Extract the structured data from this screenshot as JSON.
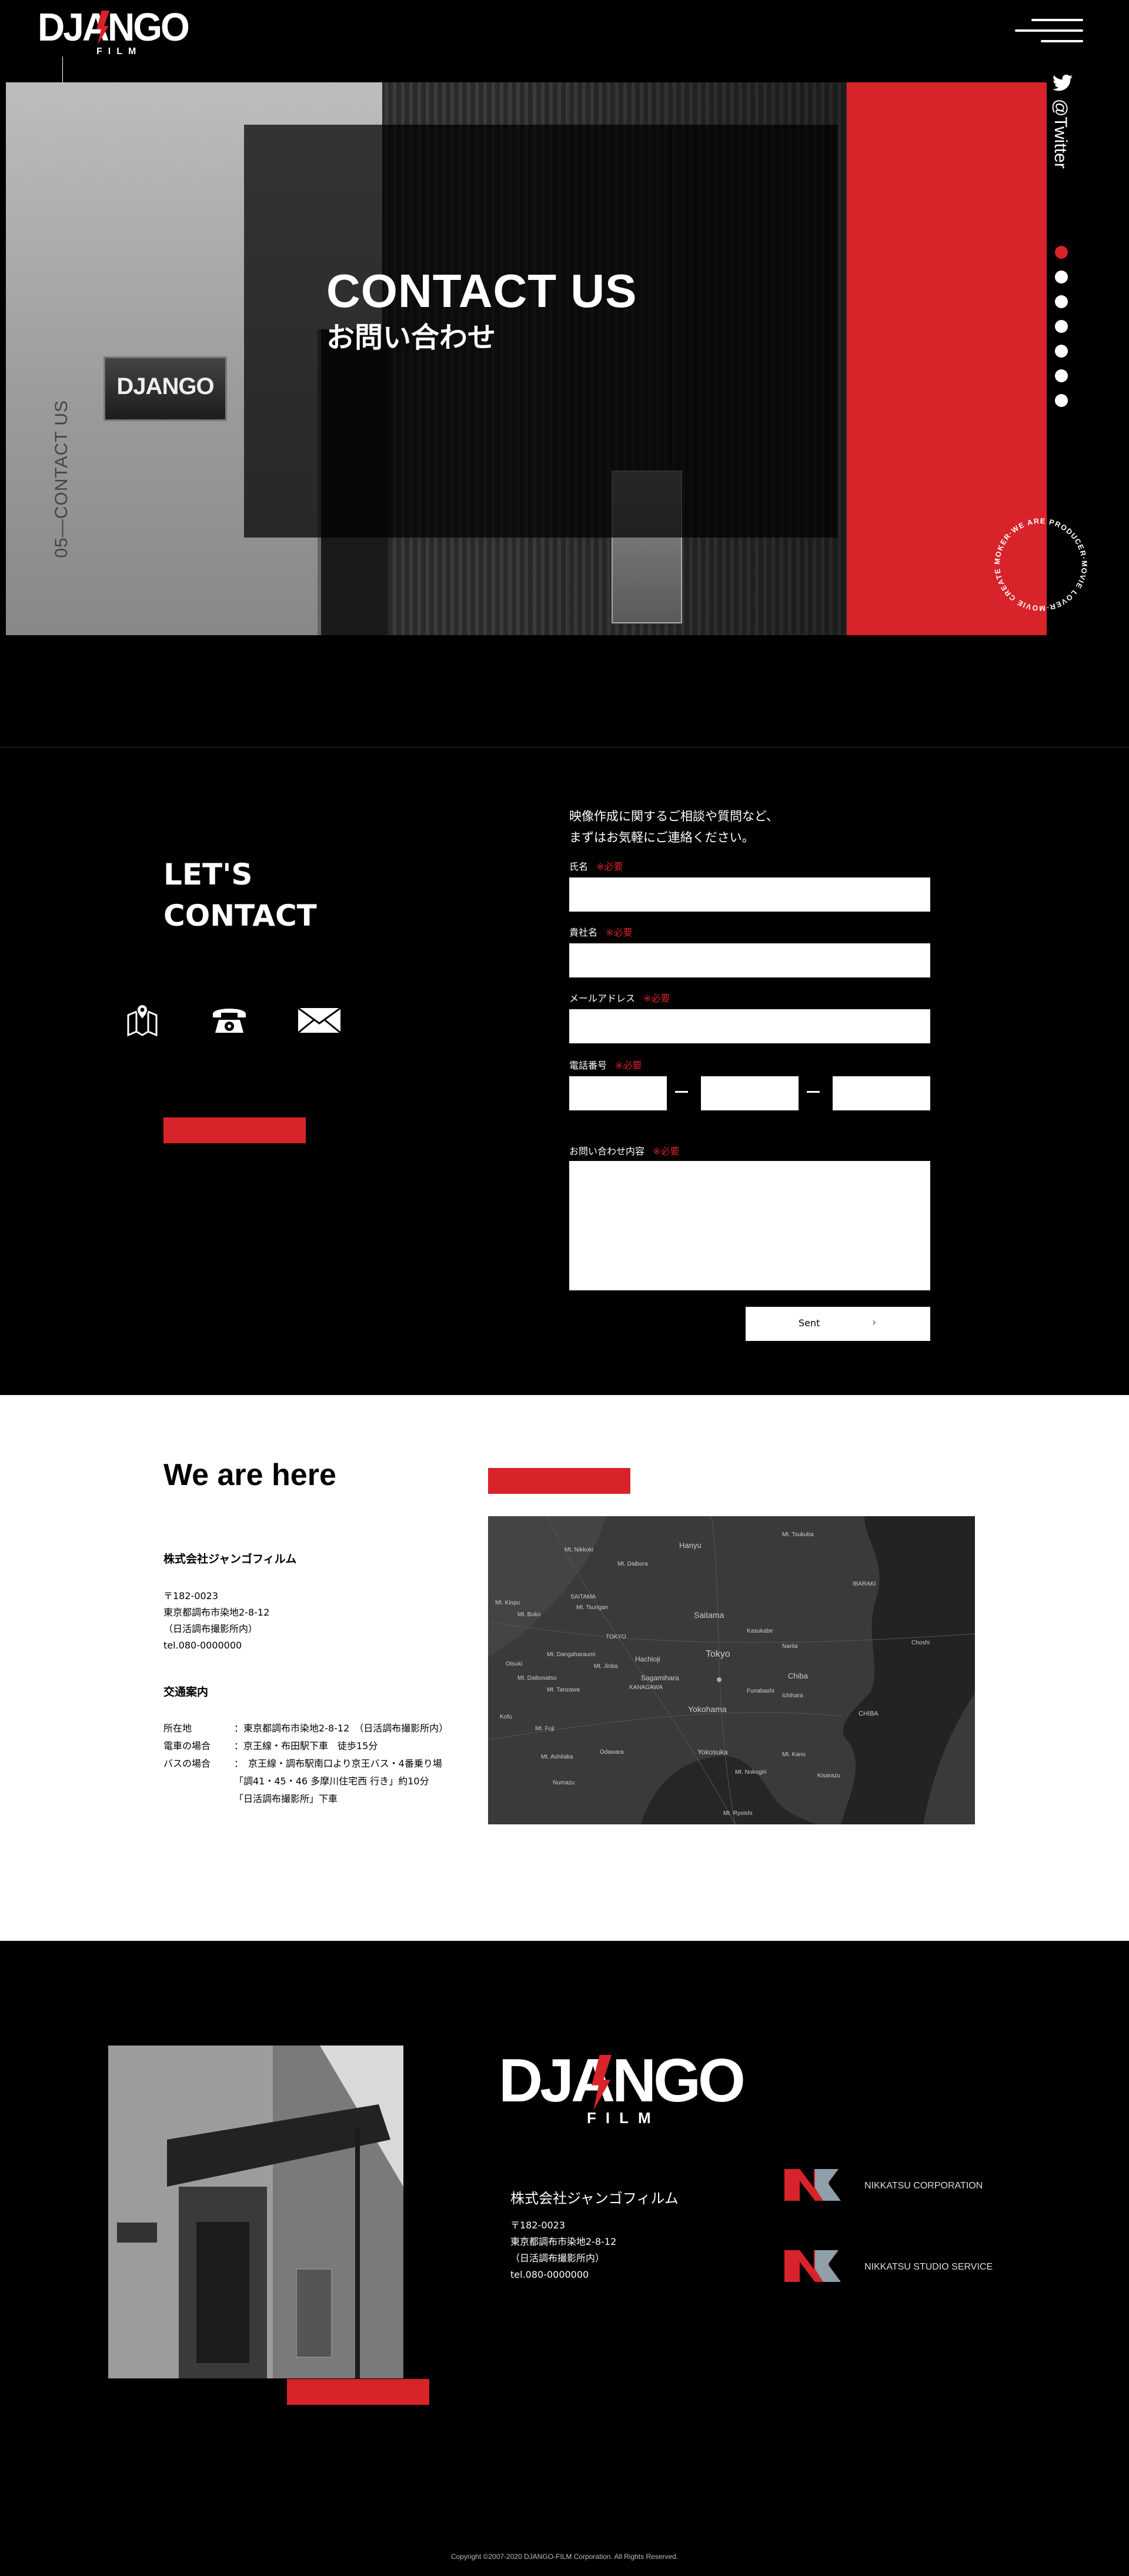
{
  "header": {
    "logo_text": "DJANGO",
    "logo_sub": "FILM",
    "menu_label": "menu"
  },
  "hero": {
    "title": "CONTACT US",
    "subtitle": "お問い合わせ",
    "side_label": "05—CONTACT US",
    "twitter_label": "@Twitter",
    "plate_text": "DJANGO",
    "badge_text": "MOKER·WE ARE PRODUCER·MOVIE LOVER·MOVIE CREATER·DREAM ",
    "accent_color": "#d8232a",
    "nav_dots_active_index": 0,
    "nav_dot_count": 7
  },
  "contact": {
    "heading_line1": "LET'S",
    "heading_line2": "CONTACT",
    "icons": [
      "map-icon",
      "phone-icon",
      "mail-icon"
    ],
    "intro_line1": "映像作成に関するご相談や質問など、",
    "intro_line2": "まずはお気軽にご連絡ください。",
    "required_mark": "※必要",
    "fields": {
      "name": "氏名",
      "company": "貴社名",
      "email": "メールアドレス",
      "phone": "電話番号",
      "message": "お問い合わせ内容"
    },
    "submit_label": "Sent",
    "submit_arrow": "›"
  },
  "location": {
    "heading": "We are here",
    "company_name": "株式会社ジャンゴフィルム",
    "address_lines": [
      "〒182-0023",
      "東京都調布市染地2-8-12",
      "（日活調布撮影所内）",
      "tel.080-0000000"
    ],
    "access_title": "交通案内",
    "access": [
      {
        "label": "所在地",
        "value": "：東京都調布市染地2-8-12　（日活調布撮影所内）"
      },
      {
        "label": "電車の場合",
        "value": "：京王線・布田駅下車　徒歩15分"
      },
      {
        "label": "バスの場合",
        "value": "：　京王線・調布駅南口より京王バス・4番乗り場"
      },
      {
        "label": "",
        "value": "「調41・45・46 多摩川住宅西 行き」約10分"
      },
      {
        "label": "",
        "value": "「日活調布撮影所」下車"
      }
    ],
    "map_labels": [
      "Hanyu",
      "Mt. Nikkoki",
      "Mt. Tsukuba",
      "Mt. Daibora",
      "SAITAMA",
      "Mt. Tsurigan",
      "Mt. Kinpu",
      "Mt. Buko",
      "Saitama",
      "IBARAKI",
      "Mt. Dangaharaumi",
      "TOKYO",
      "Kasukabe",
      "Mt. Daibosatsu",
      "Narita",
      "Hachioji",
      "Tokyo",
      "Mt. Jinba",
      "Sagamihara",
      "KANAGAWA",
      "Chiba",
      "Mt. Tanzawa",
      "Ichihara",
      "Yokohama",
      "CHIBA",
      "Mt. Fuji",
      "Odawara",
      "Yokosuka",
      "Mt. Kano",
      "Mt. Ashitaka",
      "Kisarazu",
      "Numazu",
      "Mt. Nokogiri",
      "Mt. Ryoishi",
      "Funabashi",
      "Choshi",
      "Kofu",
      "Otsuki"
    ]
  },
  "footer": {
    "logo_text": "DJANGO",
    "logo_sub": "FILM",
    "company_name": "株式会社ジャンゴフィルム",
    "address_lines": [
      "〒182-0023",
      "東京都調布市染地2-8-12",
      "（日活調布撮影所内）",
      "tel.080-0000000"
    ],
    "partners": [
      "NIKKATSU CORPORATION",
      "NIKKATSU STUDIO SERVICE"
    ],
    "copyright": "Copyright ©2007-2020 DJANGO-FILM Corporation. All Rights Reserved."
  }
}
